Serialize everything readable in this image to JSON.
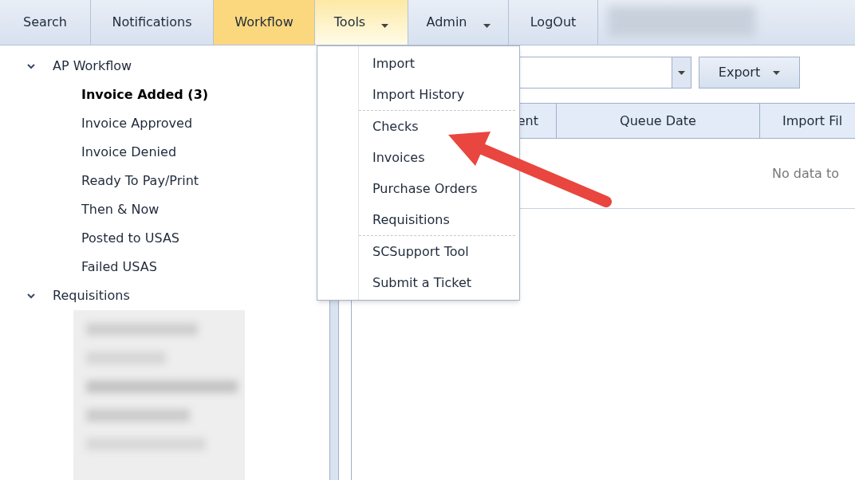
{
  "nav": [
    {
      "label": "Search",
      "selected": false,
      "has_menu": false,
      "expanded": false
    },
    {
      "label": "Notifications",
      "selected": false,
      "has_menu": false,
      "expanded": false
    },
    {
      "label": "Workflow",
      "selected": true,
      "has_menu": false,
      "expanded": false
    },
    {
      "label": "Tools",
      "selected": false,
      "has_menu": true,
      "expanded": true
    },
    {
      "label": "Admin",
      "selected": false,
      "has_menu": true,
      "expanded": false
    },
    {
      "label": "LogOut",
      "selected": false,
      "has_menu": false,
      "expanded": false
    }
  ],
  "tools_menu": {
    "groups": [
      [
        "Import",
        "Import History"
      ],
      [
        "Checks",
        "Invoices",
        "Purchase Orders",
        "Requisitions"
      ],
      [
        "SCSupport Tool",
        "Submit a Ticket"
      ]
    ]
  },
  "tree": [
    {
      "label": "AP Workflow",
      "expanded": true,
      "children": [
        {
          "label": "Invoice Added (3)",
          "selected": true
        },
        {
          "label": "Invoice Approved",
          "selected": false
        },
        {
          "label": "Invoice Denied",
          "selected": false
        },
        {
          "label": "Ready To Pay/Print",
          "selected": false
        },
        {
          "label": "Then & Now",
          "selected": false
        },
        {
          "label": "Posted to USAS",
          "selected": false
        },
        {
          "label": "Failed USAS",
          "selected": false
        }
      ]
    },
    {
      "label": "Requisitions",
      "expanded": true
    }
  ],
  "toolbar": {
    "export_button": "Export"
  },
  "table": {
    "columns": [
      "ent",
      "Queue Date",
      "Import Fil"
    ],
    "empty_message": "No data to"
  }
}
